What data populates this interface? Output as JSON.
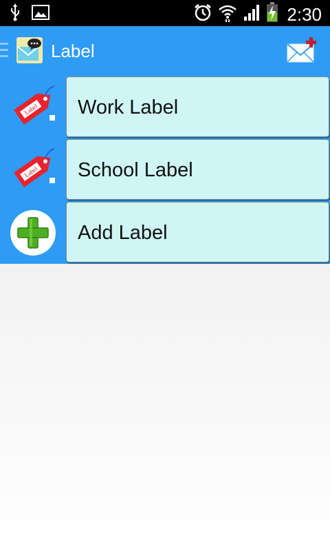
{
  "status_bar": {
    "time": "2:30",
    "icons": [
      "usb-icon",
      "image-icon",
      "alarm-icon",
      "wifi-icon",
      "signal-icon",
      "battery-charging-icon"
    ]
  },
  "action_bar": {
    "title": "Label",
    "app_icon": "app-logo-icon",
    "compose_icon": "compose-mail-icon"
  },
  "labels": [
    {
      "text": "Work Label",
      "icon": "label-tag-icon",
      "tag_text": "Label"
    },
    {
      "text": "School Label",
      "icon": "label-tag-icon",
      "tag_text": "Label"
    },
    {
      "text": "Add Label",
      "icon": "add-plus-icon"
    }
  ],
  "colors": {
    "accent": "#2e9bf5",
    "card_bg": "#cff5f5",
    "tag_red": "#e8232c",
    "plus_green": "#4caf22"
  }
}
